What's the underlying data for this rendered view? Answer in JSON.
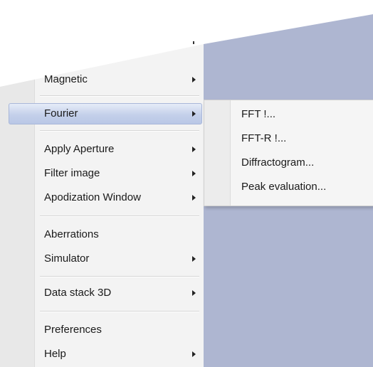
{
  "menu": {
    "items": [
      {
        "label": "Magnetic",
        "has_submenu": true
      },
      {
        "label": "Fourier",
        "has_submenu": true,
        "highlighted": true
      },
      {
        "label": "Apply Aperture",
        "has_submenu": true
      },
      {
        "label": "Filter image",
        "has_submenu": true
      },
      {
        "label": "Apodization Window",
        "has_submenu": true
      },
      {
        "label": "Aberrations",
        "has_submenu": false
      },
      {
        "label": "Simulator",
        "has_submenu": true
      },
      {
        "label": "Data stack 3D",
        "has_submenu": true
      },
      {
        "label": "Preferences",
        "has_submenu": false
      },
      {
        "label": "Help",
        "has_submenu": true
      }
    ]
  },
  "submenu": {
    "items": [
      {
        "label": "FFT !..."
      },
      {
        "label": "FFT-R !..."
      },
      {
        "label": "Diffractogram..."
      },
      {
        "label": "Peak evaluation..."
      }
    ]
  },
  "colors": {
    "background_app": "#aeb6d1",
    "menu_bg": "#f3f3f3",
    "highlight": "#c4d0ea"
  }
}
